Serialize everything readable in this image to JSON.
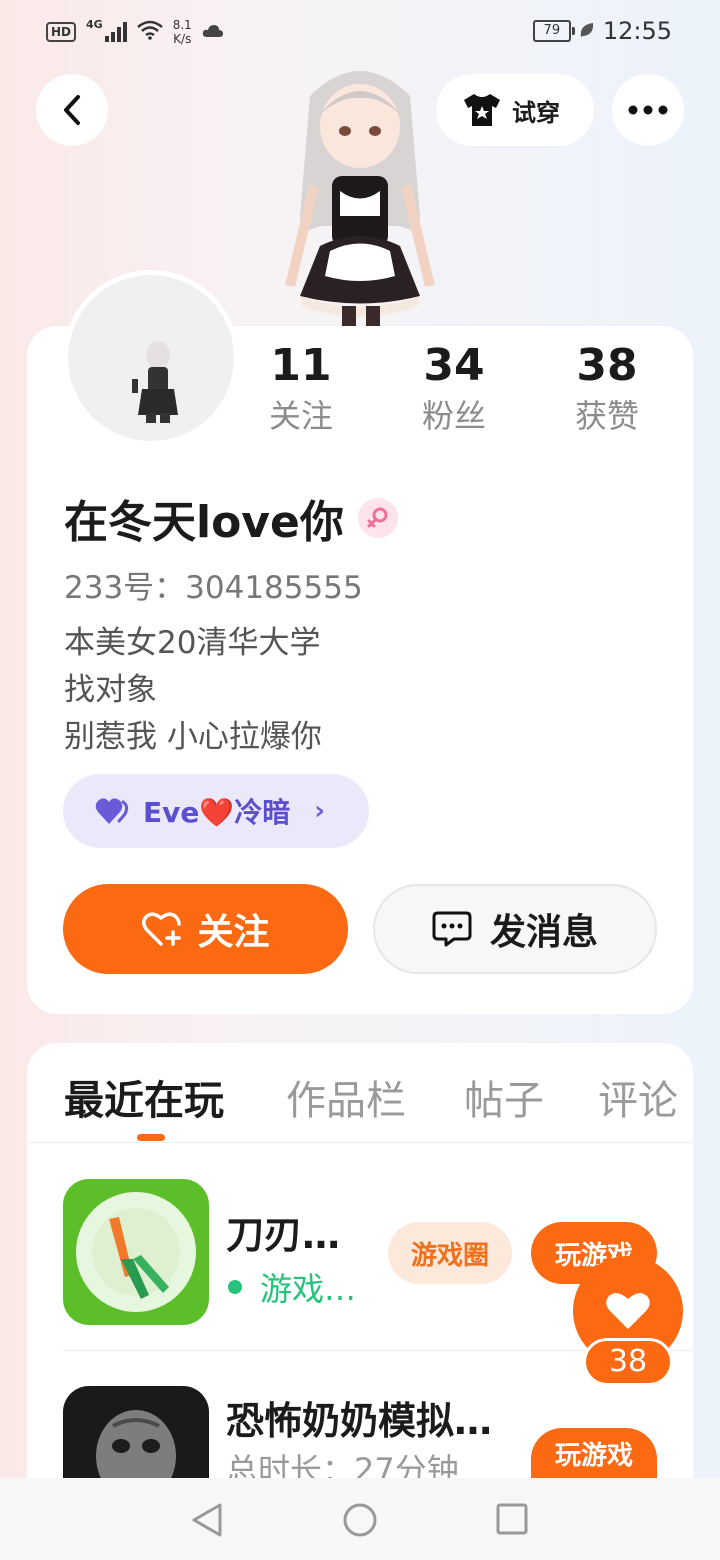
{
  "status_bar": {
    "hd": "HD",
    "network": "4G",
    "speed_value": "8.1",
    "speed_unit": "K/s",
    "battery": "79",
    "time": "12:55"
  },
  "header": {
    "try_on_label": "试穿"
  },
  "profile": {
    "stats": [
      {
        "value": "11",
        "label": "关注"
      },
      {
        "value": "34",
        "label": "粉丝"
      },
      {
        "value": "38",
        "label": "获赞"
      }
    ],
    "name": "在冬天love你",
    "uid": "233号：304185555",
    "bio": [
      "本美女20清华大学",
      "找对象",
      "别惹我 小心拉爆你"
    ],
    "cp_tag": "Eve❤️冷暗",
    "follow_label": "关注",
    "message_label": "发消息"
  },
  "tabs": [
    {
      "label": "最近在玩",
      "active": true
    },
    {
      "label": "作品栏",
      "active": false
    },
    {
      "label": "帖子",
      "active": false
    },
    {
      "label": "评论",
      "active": false
    }
  ],
  "games": [
    {
      "title": "刀刃…",
      "sub": "游戏…",
      "circle_label": "游戏圈",
      "play_label": "玩游戏"
    },
    {
      "title": "恐怖奶奶模拟…",
      "sub": "总时长：27分钟",
      "play_label": "玩游戏"
    }
  ],
  "like_count": "38",
  "colors": {
    "accent": "#fb6a12",
    "online": "#27c37a",
    "cp_text": "#5a4fd0"
  }
}
